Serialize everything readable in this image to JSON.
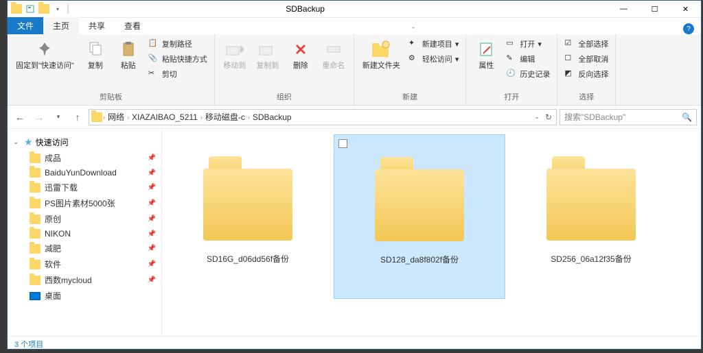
{
  "window": {
    "title": "SDBackup"
  },
  "tabs": {
    "file": "文件",
    "home": "主页",
    "share": "共享",
    "view": "查看"
  },
  "ribbon": {
    "pin": "固定到\"快速访问\"",
    "copy": "复制",
    "paste": "粘贴",
    "copy_path": "复制路径",
    "paste_shortcut": "粘贴快捷方式",
    "cut": "剪切",
    "clipboard_group": "剪贴板",
    "move_to": "移动到",
    "copy_to": "复制到",
    "delete": "删除",
    "rename": "重命名",
    "organize_group": "组织",
    "new_folder": "新建文件夹",
    "new_item": "新建项目",
    "easy_access": "轻松访问",
    "new_group": "新建",
    "properties": "属性",
    "open": "打开",
    "edit": "编辑",
    "history": "历史记录",
    "open_group": "打开",
    "select_all": "全部选择",
    "select_none": "全部取消",
    "invert_selection": "反向选择",
    "select_group": "选择"
  },
  "breadcrumbs": [
    "网络",
    "XIAZAIBAO_5211",
    "移动磁盘-c",
    "SDBackup"
  ],
  "search": {
    "placeholder": "搜索\"SDBackup\""
  },
  "navpane": {
    "quick_access": "快速访问",
    "items": [
      {
        "label": "成品"
      },
      {
        "label": "BaiduYunDownload"
      },
      {
        "label": "迅雷下载"
      },
      {
        "label": "PS图片素材5000张"
      },
      {
        "label": "原创"
      },
      {
        "label": "NIKON"
      },
      {
        "label": "减肥"
      },
      {
        "label": "软件"
      },
      {
        "label": "西数mycloud"
      }
    ],
    "desktop": "桌面"
  },
  "folders": [
    {
      "name": "SD16G_d06dd56f备份",
      "selected": false
    },
    {
      "name": "SD128_da8f802f备份",
      "selected": true
    },
    {
      "name": "SD256_06a12f35备份",
      "selected": false
    }
  ],
  "status": {
    "count": "3 个项目"
  }
}
